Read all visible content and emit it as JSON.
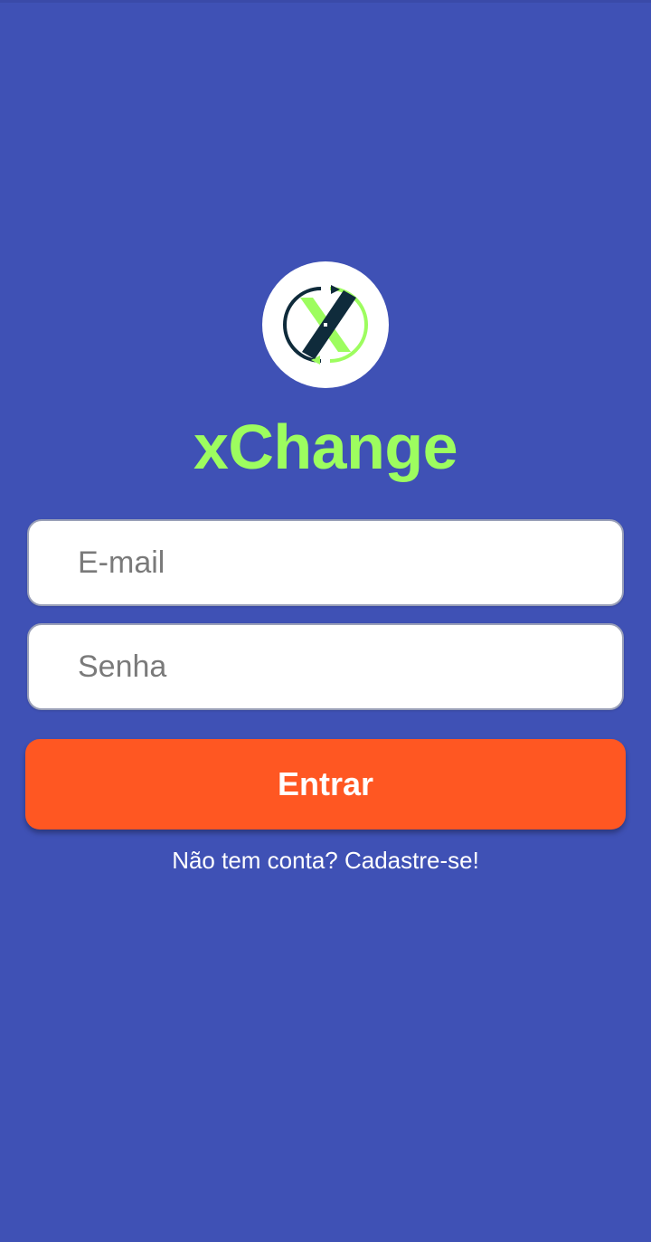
{
  "app": {
    "name": "xChange",
    "logo_icon": "xchange-exchange-logo-icon"
  },
  "login_form": {
    "email_placeholder": "E-mail",
    "email_value": "",
    "password_placeholder": "Senha",
    "password_value": "",
    "submit_label": "Entrar",
    "signup_link": "Não tem conta? Cadastre-se!"
  },
  "colors": {
    "background": "#3f51b5",
    "brand_text": "#9dfd5f",
    "button": "#ff5722",
    "logo_dark": "#0f2b3b",
    "logo_green": "#9dfd5f"
  }
}
